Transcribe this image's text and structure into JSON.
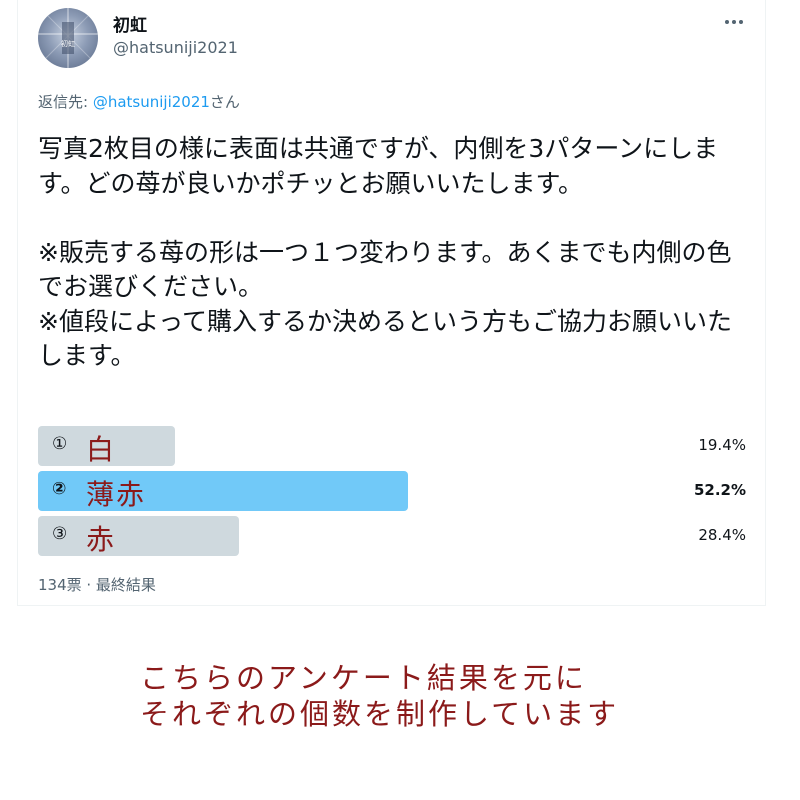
{
  "tweet": {
    "author": {
      "display_name": "初虹",
      "handle": "@hatsuniji2021",
      "avatar_text": "初虹"
    },
    "reply_prefix": "返信先: ",
    "reply_mention": "@hatsuniji2021",
    "reply_suffix": "さん",
    "text": "写真2枚目の様に表面は共通ですが、内側を3パターンにします。どの苺が良いかポチッとお願いいたします。\n\n※販売する苺の形は一つ１つ変わります。あくまでも内側の色でお選びください。\n※値段によって購入するか決めるという方もご協力お願いいたします。",
    "poll": {
      "options": [
        {
          "number": "①",
          "label": "白",
          "percent": "19.4%",
          "value": 19.4
        },
        {
          "number": "②",
          "label": "薄赤",
          "percent": "52.2%",
          "value": 52.2
        },
        {
          "number": "③",
          "label": "赤",
          "percent": "28.4%",
          "value": 28.4
        }
      ],
      "winner_index": 1,
      "meta": "134票 · 最終結果"
    }
  },
  "caption": {
    "line1": "こちらのアンケート結果を元に",
    "line2": "それぞれの個数を制作しています"
  },
  "colors": {
    "poll_bar": "#cfd9de",
    "poll_bar_winner": "#71c9f8",
    "mention": "#1d9bf0",
    "caption": "#8b1a1a"
  },
  "icons": {
    "more": "more-horizontal-icon"
  }
}
